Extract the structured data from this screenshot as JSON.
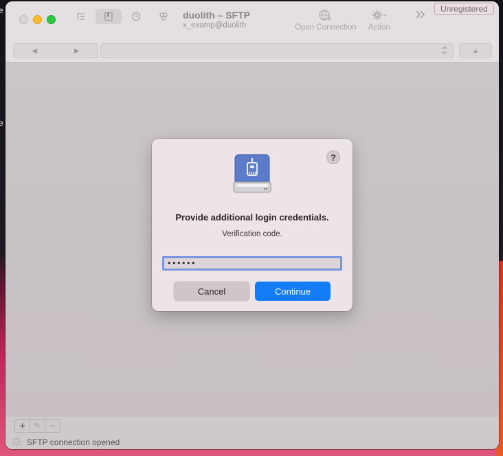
{
  "desktop": {
    "left_edge_glyphs": [
      "e",
      "e"
    ]
  },
  "window": {
    "title": "duolith – SFTP",
    "subtitle": "x_examp@duolith",
    "unregistered_label": "Unregistered",
    "toolbar": {
      "open_connection_label": "Open Connection",
      "action_label": "Action",
      "icons": [
        "outline-view-icon",
        "bookmarks-icon",
        "history-icon",
        "bonjour-icon",
        "open-connection-icon",
        "gear-icon",
        "toolbar-overflow-icon"
      ]
    },
    "nav": {
      "back": "◀",
      "forward": "▶",
      "up": "▲"
    }
  },
  "dialog": {
    "title": "Provide additional login credentials.",
    "message": "Verification code.",
    "input_value": "••••••",
    "cancel_label": "Cancel",
    "continue_label": "Continue",
    "help_label": "?"
  },
  "bottom_toolbar": {
    "add": "+",
    "edit": "✎",
    "remove": "−"
  },
  "status": {
    "text": "SFTP connection opened"
  },
  "colors": {
    "accent": "#157cf7",
    "focus_ring": "#7a96e0",
    "minimize": "#fdbc2e",
    "maximize": "#29c840"
  }
}
